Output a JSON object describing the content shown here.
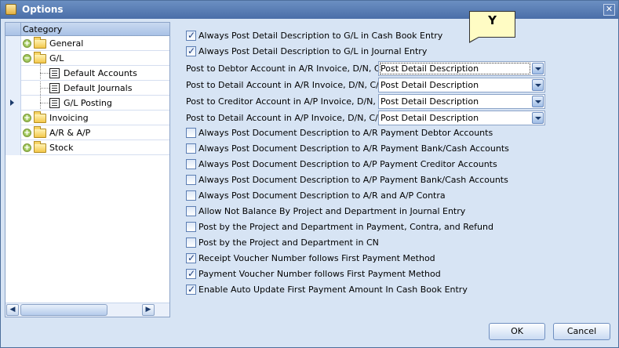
{
  "window": {
    "title": "Options"
  },
  "tree": {
    "header": "Category",
    "items": [
      {
        "label": "General"
      },
      {
        "label": "G/L"
      },
      {
        "label": "Default Accounts"
      },
      {
        "label": "Default Journals"
      },
      {
        "label": "G/L Posting"
      },
      {
        "label": "Invoicing"
      },
      {
        "label": "A/R & A/P"
      },
      {
        "label": "Stock"
      }
    ],
    "selected": "G/L Posting"
  },
  "tooltip": {
    "text": "Y"
  },
  "options_top": [
    {
      "label": "Always Post Detail Description to G/L in Cash Book Entry",
      "checked": true
    },
    {
      "label": "Always Post Detail Description to G/L in Journal Entry",
      "checked": true
    }
  ],
  "combos": [
    {
      "label": "Post to Debtor Account in A/R Invoice, D/N, C/N",
      "value": "Post Detail Description"
    },
    {
      "label": "Post to Detail Account in A/R Invoice, D/N, C/N",
      "value": "Post Detail Description"
    },
    {
      "label": "Post to Creditor Account in A/P Invoice, D/N, C/N",
      "value": "Post Detail Description"
    },
    {
      "label": "Post to Detail Account in A/P Invoice, D/N, C/N",
      "value": "Post Detail Description"
    }
  ],
  "options": [
    {
      "label": "Always Post Document Description to A/R Payment Debtor Accounts",
      "checked": false
    },
    {
      "label": "Always Post Document Description to A/R Payment Bank/Cash Accounts",
      "checked": false
    },
    {
      "label": "Always Post Document Description to A/P Payment Creditor Accounts",
      "checked": false
    },
    {
      "label": "Always Post Document Description to A/P Payment Bank/Cash Accounts",
      "checked": false
    },
    {
      "label": "Always Post Document Description to A/R and A/P Contra",
      "checked": false
    },
    {
      "label": "Allow Not Balance By Project and Department in Journal Entry",
      "checked": false
    },
    {
      "label": "Post by the Project and Department in Payment, Contra, and Refund",
      "checked": false
    },
    {
      "label": "Post by the Project and Department in CN",
      "checked": false
    },
    {
      "label": "Receipt Voucher Number follows First Payment Method",
      "checked": true
    },
    {
      "label": "Payment Voucher Number follows First Payment Method",
      "checked": true
    },
    {
      "label": "Enable Auto Update First Payment Amount In Cash Book Entry",
      "checked": true
    }
  ],
  "buttons": {
    "ok": "OK",
    "cancel": "Cancel"
  }
}
